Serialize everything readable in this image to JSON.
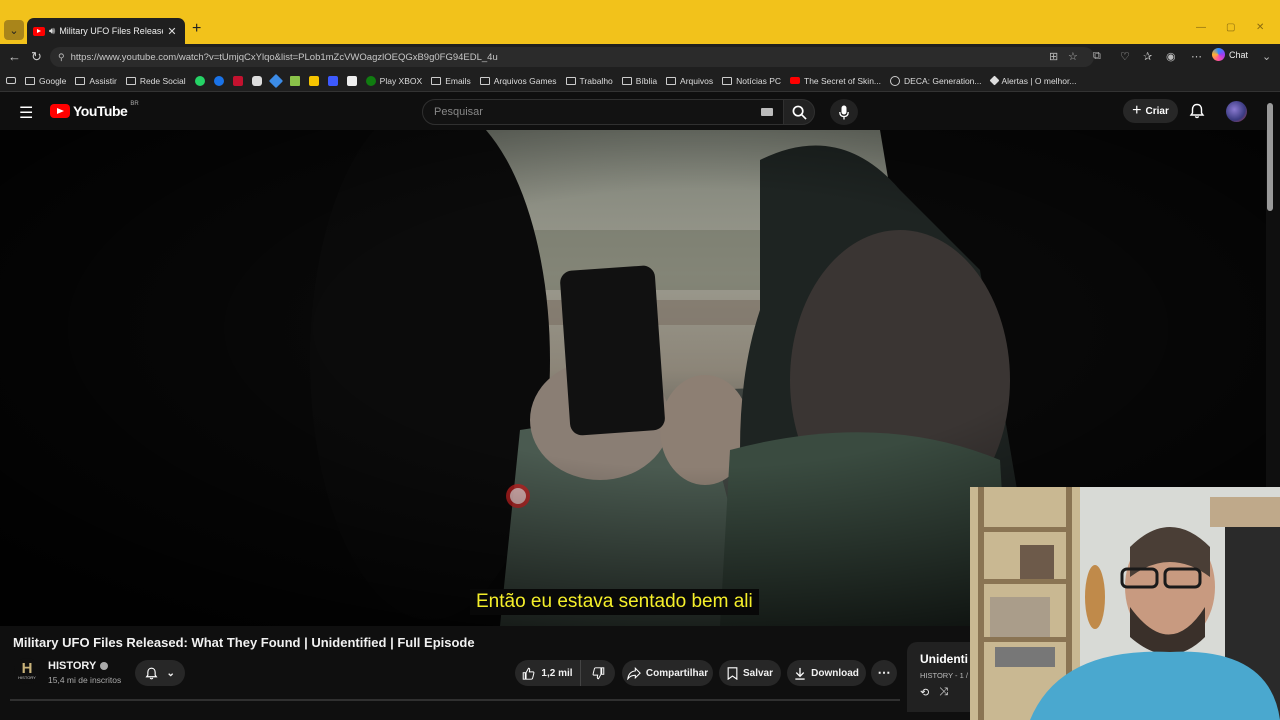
{
  "browser": {
    "tab_title": "Military UFO Files Released: W",
    "url": "https://www.youtube.com/watch?v=tUmjqCxYlqo&list=PLob1mZcVWOagzlOEQGxB9g0FG94EDL_4u",
    "chat_label": "Chat",
    "bookmarks": [
      {
        "label": "Google",
        "icon": "folder-icon"
      },
      {
        "label": "Assistir",
        "icon": "folder-icon"
      },
      {
        "label": "Rede Social",
        "icon": "folder-icon"
      },
      {
        "label": "Play XBOX",
        "icon": "xbox-icon"
      },
      {
        "label": "Emails",
        "icon": "folder-icon"
      },
      {
        "label": "Arquivos Games",
        "icon": "folder-icon"
      },
      {
        "label": "Trabalho",
        "icon": "folder-icon"
      },
      {
        "label": "Bíblia",
        "icon": "folder-icon"
      },
      {
        "label": "Arquivos",
        "icon": "folder-icon"
      },
      {
        "label": "Notícias PC",
        "icon": "folder-icon"
      },
      {
        "label": "The Secret of Skin...",
        "icon": "youtube-icon"
      },
      {
        "label": "DECA: Generation...",
        "icon": "globe-icon"
      },
      {
        "label": "Alertas | O melhor...",
        "icon": "alert-icon"
      }
    ]
  },
  "header": {
    "logo_text": "YouTube",
    "region": "BR",
    "search_placeholder": "Pesquisar",
    "create_label": "Criar"
  },
  "video": {
    "subtitle": "Então eu estava sentado bem ali",
    "title": "Military UFO Files Released: What They Found | Unidentified | Full Episode"
  },
  "channel": {
    "name": "HISTORY",
    "logo_letter": "H",
    "logo_text": "HISTORY",
    "subscribers": "15,4 mi de inscritos"
  },
  "actions": {
    "likes": "1,2 mil",
    "share": "Compartilhar",
    "save": "Salvar",
    "download": "Download"
  },
  "playlist": {
    "title": "Unidenti",
    "subtitle": "HISTORY - 1 /"
  },
  "colors": {
    "browser_frame": "#f2c21b",
    "subtitle": "#f5ef2a",
    "youtube_red": "#ff0000"
  }
}
